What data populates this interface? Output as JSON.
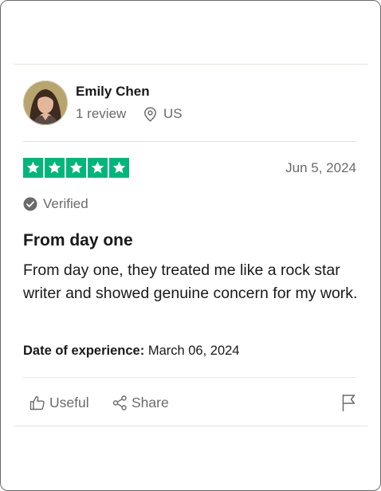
{
  "reviewer": {
    "name": "Emily Chen",
    "review_count": "1 review",
    "location": "US",
    "avatar_icon": "user-avatar-photo"
  },
  "rating": {
    "stars": 5,
    "max_stars": 5,
    "star_color": "#00b67a"
  },
  "review": {
    "date": "Jun 5, 2024",
    "verified_label": "Verified",
    "title": "From day one",
    "body": "From day one, they treated me like a rock star writer and showed genuine concern for my work.",
    "experience_label": "Date of experience:",
    "experience_date": "March 06, 2024"
  },
  "actions": {
    "useful_label": "Useful",
    "share_label": "Share",
    "useful_icon": "thumbs-up-icon",
    "share_icon": "share-icon",
    "flag_icon": "flag-icon"
  },
  "colors": {
    "text_primary": "#191919",
    "text_secondary": "#6a6a6a",
    "star_green": "#00b67a"
  }
}
